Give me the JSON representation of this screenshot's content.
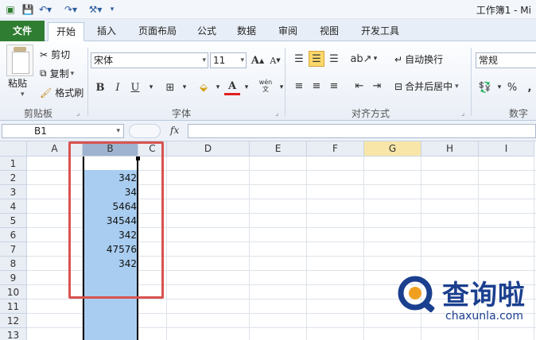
{
  "window": {
    "title": "工作簿1 - Mi"
  },
  "ribbon_tabs": [
    {
      "label": "文件"
    },
    {
      "label": "开始"
    },
    {
      "label": "插入"
    },
    {
      "label": "页面布局"
    },
    {
      "label": "公式"
    },
    {
      "label": "数据"
    },
    {
      "label": "审阅"
    },
    {
      "label": "视图"
    },
    {
      "label": "开发工具"
    }
  ],
  "clipboard": {
    "paste_label": "粘贴",
    "cut_label": "剪切",
    "copy_label": "复制",
    "format_painter_label": "格式刷",
    "group_label": "剪贴板"
  },
  "font": {
    "name": "宋体",
    "size": "11",
    "group_label": "字体",
    "bold": "B",
    "italic": "I",
    "underline": "U",
    "grow": "A",
    "shrink": "A",
    "wen": "wén"
  },
  "alignment": {
    "wrap_text_label": "自动换行",
    "merge_center_label": "合并后居中",
    "group_label": "对齐方式"
  },
  "number": {
    "format": "常规",
    "group_label": "数字",
    "percent": "%",
    "comma": ","
  },
  "formula_bar": {
    "name_box": "B1",
    "fx": "fx"
  },
  "grid": {
    "columns": [
      "A",
      "B",
      "C",
      "D",
      "E",
      "F",
      "G",
      "H",
      "I"
    ],
    "rows": [
      "1",
      "2",
      "3",
      "4",
      "5",
      "6",
      "7",
      "8",
      "9",
      "10",
      "11",
      "12",
      "13"
    ],
    "column_b_values": [
      "",
      "342",
      "34",
      "5464",
      "34544",
      "342",
      "47576",
      "342"
    ]
  },
  "watermark": {
    "brand": "查询啦",
    "url": "chaxunla.com"
  },
  "colors": {
    "accent": "#2f7d32",
    "selection": "#a9cdf0",
    "highlight_box": "#d9534f"
  }
}
